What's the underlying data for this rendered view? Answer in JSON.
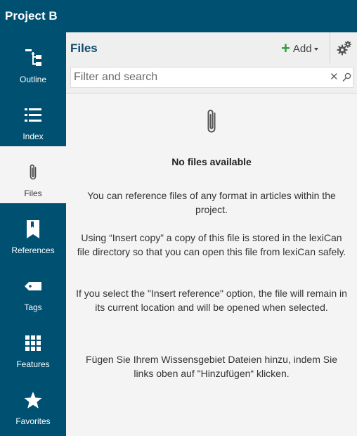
{
  "app": {
    "title": "Project B"
  },
  "sidebar": {
    "items": [
      {
        "label": "Outline",
        "icon": "outline-tree-icon",
        "active": false
      },
      {
        "label": "Index",
        "icon": "list-icon",
        "active": false
      },
      {
        "label": "Files",
        "icon": "paperclip-icon",
        "active": true
      },
      {
        "label": "References",
        "icon": "bookmark-icon",
        "active": false
      },
      {
        "label": "Tags",
        "icon": "tag-icon",
        "active": false
      },
      {
        "label": "Features",
        "icon": "grid-icon",
        "active": false
      },
      {
        "label": "Favorites",
        "icon": "star-icon",
        "active": false
      }
    ]
  },
  "panel": {
    "title": "Files",
    "add_label": "Add",
    "search": {
      "placeholder": "Filter and search",
      "value": ""
    },
    "empty": {
      "title": "No files available",
      "paragraphs": [
        "You can reference files of any format in articles within the project.",
        "Using “Insert copy” a copy of this file is stored in the lexiCan file directory so that you can open this file from lexiCan safely.",
        "If you select the \"Insert reference\" option, the file will remain in its current location and will be opened when selected.",
        "Fügen Sie Ihrem Wissensgebiet Dateien hinzu, indem Sie links oben auf \"Hinzufügen“ klicken."
      ]
    }
  },
  "colors": {
    "sidebar_bg": "#005072",
    "active_bg": "#f4f4f4",
    "title_text": "#0f4a6b",
    "add_accent": "#2f9a3a"
  }
}
